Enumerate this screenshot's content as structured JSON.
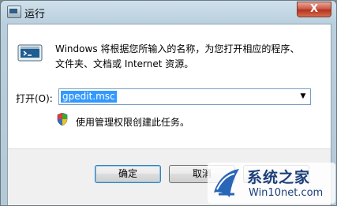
{
  "window": {
    "title": "运行",
    "close_label": "X"
  },
  "dialog": {
    "description": "Windows 将根据您所输入的名称，为您打开相应的程序、\n文件夹、文档或 Internet 资源。",
    "open_label": "打开(O):",
    "input_value": "gpedit.msc",
    "admin_note": "使用管理权限创建此任务。"
  },
  "buttons": {
    "ok": "确定",
    "cancel": "取消",
    "browse": ""
  },
  "watermark": {
    "name": "系统之家",
    "url": "Win10net.com"
  },
  "colors": {
    "selection": "#3399ff",
    "close_button": "#c8523f",
    "watermark_text": "#1b3f7a"
  }
}
